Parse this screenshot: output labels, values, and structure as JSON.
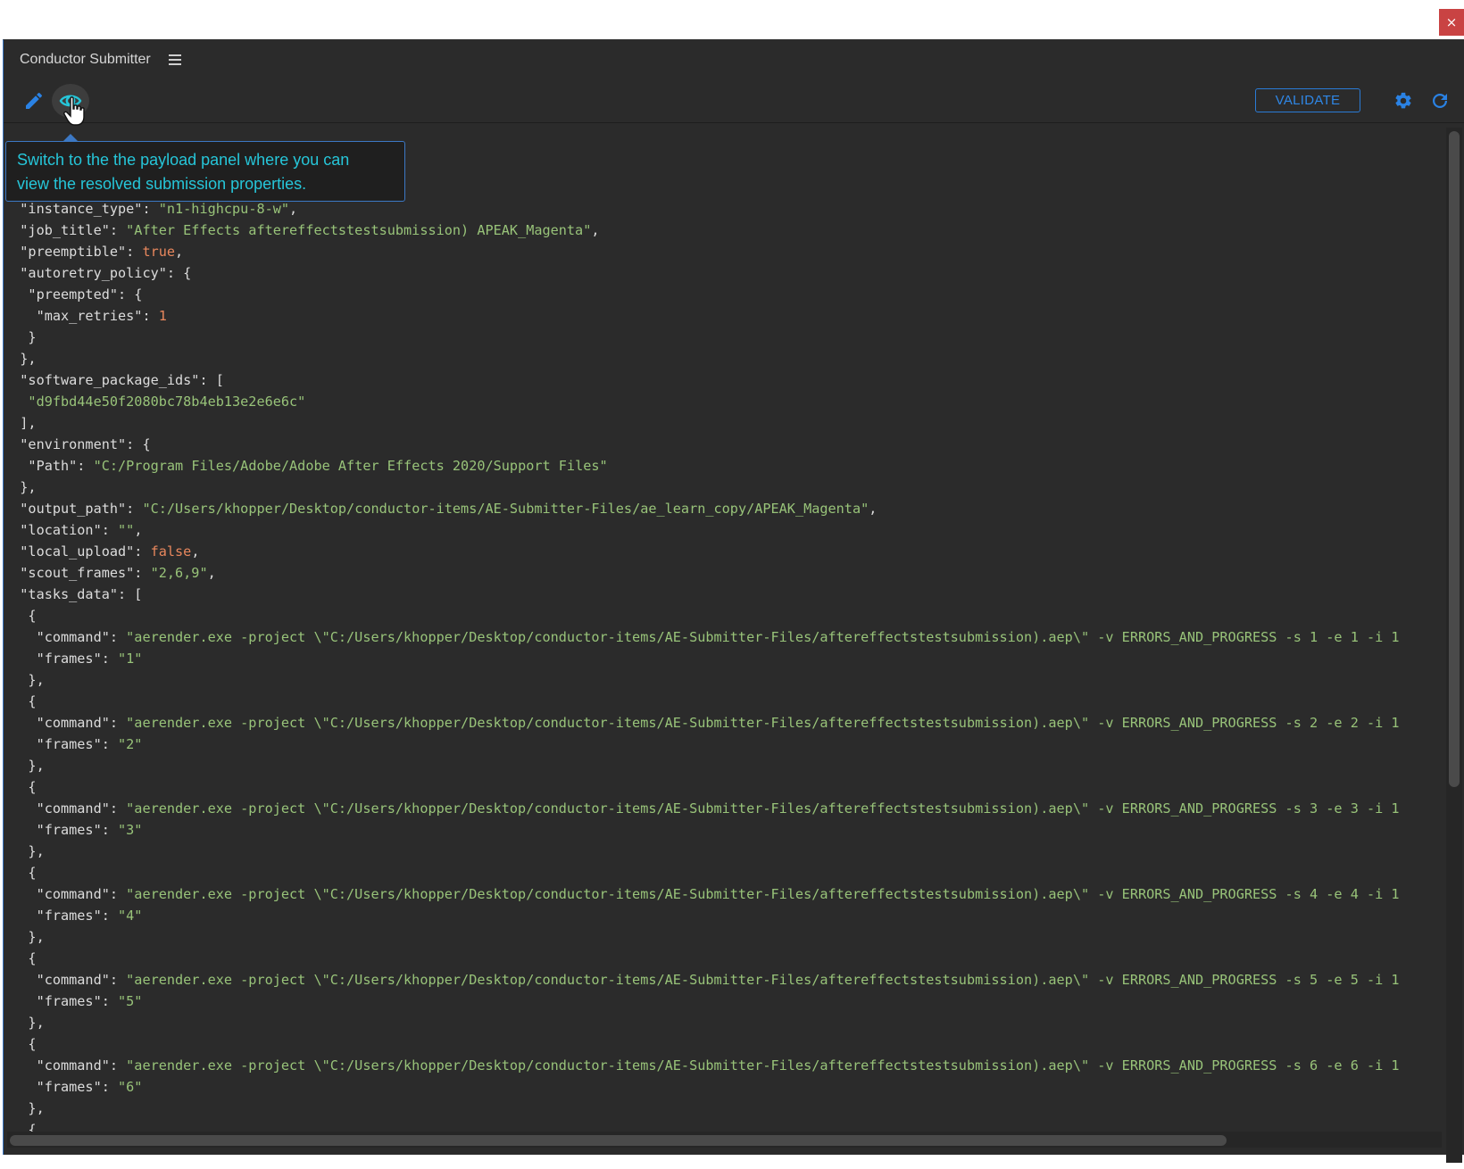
{
  "app": {
    "title": "Conductor Submitter"
  },
  "window": {
    "close_label": "×"
  },
  "toolbar": {
    "validate_label": "VALIDATE",
    "icons": [
      "pencil-icon",
      "eye-icon",
      "gear-icon",
      "refresh-icon"
    ]
  },
  "tooltip": {
    "line1": "Switch to the the payload panel where you can",
    "line2": "view the resolved submission properties."
  },
  "colors": {
    "panel_bg": "#2b2b2b",
    "accent": "#2a7bd6",
    "tooltip_text": "#26c6d9",
    "json_string": "#98c379",
    "json_literal": "#e8875d",
    "close_button": "#c94343"
  },
  "payload_lines": [
    [
      [
        "k",
        "  \"instance_type\": "
      ],
      [
        "s",
        "\"n1-highcpu-8-w\""
      ],
      [
        "k",
        ","
      ]
    ],
    [
      [
        "k",
        "  \"job_title\": "
      ],
      [
        "s",
        "\"After Effects aftereffectstestsubmission) APEAK_Magenta\""
      ],
      [
        "k",
        ","
      ]
    ],
    [
      [
        "k",
        "  \"preemptible\": "
      ],
      [
        "b",
        "true"
      ],
      [
        "k",
        ","
      ]
    ],
    [
      [
        "k",
        "  \"autoretry_policy\": {"
      ]
    ],
    [
      [
        "k",
        "   \"preempted\": {"
      ]
    ],
    [
      [
        "k",
        "    \"max_retries\": "
      ],
      [
        "n",
        "1"
      ]
    ],
    [
      [
        "k",
        "   }"
      ]
    ],
    [
      [
        "k",
        "  },"
      ]
    ],
    [
      [
        "k",
        "  \"software_package_ids\": ["
      ]
    ],
    [
      [
        "s",
        "   \"d9fbd44e50f2080bc78b4eb13e2e6e6c\""
      ]
    ],
    [
      [
        "k",
        "  ],"
      ]
    ],
    [
      [
        "k",
        "  \"environment\": {"
      ]
    ],
    [
      [
        "k",
        "   \"Path\": "
      ],
      [
        "s",
        "\"C:/Program Files/Adobe/Adobe After Effects 2020/Support Files\""
      ]
    ],
    [
      [
        "k",
        "  },"
      ]
    ],
    [
      [
        "k",
        "  \"output_path\": "
      ],
      [
        "s",
        "\"C:/Users/khopper/Desktop/conductor-items/AE-Submitter-Files/ae_learn_copy/APEAK_Magenta\""
      ],
      [
        "k",
        ","
      ]
    ],
    [
      [
        "k",
        "  \"location\": "
      ],
      [
        "s",
        "\"\""
      ],
      [
        "k",
        ","
      ]
    ],
    [
      [
        "k",
        "  \"local_upload\": "
      ],
      [
        "b",
        "false"
      ],
      [
        "k",
        ","
      ]
    ],
    [
      [
        "k",
        "  \"scout_frames\": "
      ],
      [
        "s",
        "\"2,6,9\""
      ],
      [
        "k",
        ","
      ]
    ],
    [
      [
        "k",
        "  \"tasks_data\": ["
      ]
    ],
    [
      [
        "k",
        "   {"
      ]
    ],
    [
      [
        "k",
        "    \"command\": "
      ],
      [
        "s",
        "\"aerender.exe -project \\\"C:/Users/khopper/Desktop/conductor-items/AE-Submitter-Files/aftereffectstestsubmission).aep\\\" -v ERRORS_AND_PROGRESS -s 1 -e 1 -i 1"
      ]
    ],
    [
      [
        "k",
        "    \"frames\": "
      ],
      [
        "s",
        "\"1\""
      ]
    ],
    [
      [
        "k",
        "   },"
      ]
    ],
    [
      [
        "k",
        "   {"
      ]
    ],
    [
      [
        "k",
        "    \"command\": "
      ],
      [
        "s",
        "\"aerender.exe -project \\\"C:/Users/khopper/Desktop/conductor-items/AE-Submitter-Files/aftereffectstestsubmission).aep\\\" -v ERRORS_AND_PROGRESS -s 2 -e 2 -i 1"
      ]
    ],
    [
      [
        "k",
        "    \"frames\": "
      ],
      [
        "s",
        "\"2\""
      ]
    ],
    [
      [
        "k",
        "   },"
      ]
    ],
    [
      [
        "k",
        "   {"
      ]
    ],
    [
      [
        "k",
        "    \"command\": "
      ],
      [
        "s",
        "\"aerender.exe -project \\\"C:/Users/khopper/Desktop/conductor-items/AE-Submitter-Files/aftereffectstestsubmission).aep\\\" -v ERRORS_AND_PROGRESS -s 3 -e 3 -i 1"
      ]
    ],
    [
      [
        "k",
        "    \"frames\": "
      ],
      [
        "s",
        "\"3\""
      ]
    ],
    [
      [
        "k",
        "   },"
      ]
    ],
    [
      [
        "k",
        "   {"
      ]
    ],
    [
      [
        "k",
        "    \"command\": "
      ],
      [
        "s",
        "\"aerender.exe -project \\\"C:/Users/khopper/Desktop/conductor-items/AE-Submitter-Files/aftereffectstestsubmission).aep\\\" -v ERRORS_AND_PROGRESS -s 4 -e 4 -i 1"
      ]
    ],
    [
      [
        "k",
        "    \"frames\": "
      ],
      [
        "s",
        "\"4\""
      ]
    ],
    [
      [
        "k",
        "   },"
      ]
    ],
    [
      [
        "k",
        "   {"
      ]
    ],
    [
      [
        "k",
        "    \"command\": "
      ],
      [
        "s",
        "\"aerender.exe -project \\\"C:/Users/khopper/Desktop/conductor-items/AE-Submitter-Files/aftereffectstestsubmission).aep\\\" -v ERRORS_AND_PROGRESS -s 5 -e 5 -i 1"
      ]
    ],
    [
      [
        "k",
        "    \"frames\": "
      ],
      [
        "s",
        "\"5\""
      ]
    ],
    [
      [
        "k",
        "   },"
      ]
    ],
    [
      [
        "k",
        "   {"
      ]
    ],
    [
      [
        "k",
        "    \"command\": "
      ],
      [
        "s",
        "\"aerender.exe -project \\\"C:/Users/khopper/Desktop/conductor-items/AE-Submitter-Files/aftereffectstestsubmission).aep\\\" -v ERRORS_AND_PROGRESS -s 6 -e 6 -i 1"
      ]
    ],
    [
      [
        "k",
        "    \"frames\": "
      ],
      [
        "s",
        "\"6\""
      ]
    ],
    [
      [
        "k",
        "   },"
      ]
    ],
    [
      [
        "k",
        "   {"
      ]
    ]
  ]
}
